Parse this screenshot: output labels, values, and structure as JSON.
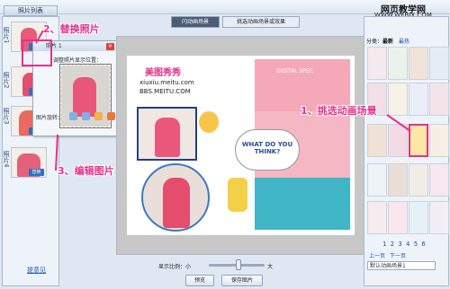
{
  "left": {
    "header": "照片列表",
    "slots": [
      "照片1",
      "照片2",
      "照片3",
      "照片4"
    ],
    "thumb_button": "替换",
    "feedback": "提意见"
  },
  "edit_panel": {
    "title": "照片 1",
    "hint": "调整照片显示位置：",
    "rotate_label": "图片旋转："
  },
  "tabs": [
    "闪动画场景",
    "挑选动画场景或效果"
  ],
  "poster": {
    "title": "美图秀秀",
    "url": "xiuxiu.meitu.com",
    "site": "BBS.MEITU.COM",
    "bubble": "WHAT DO YOU THINK?",
    "spec_text": "DIGITAL SPEC"
  },
  "bottom": {
    "zoom_label": "显示比例：",
    "zoom_min": "小",
    "zoom_max": "大",
    "preview": "预览",
    "save": "保存图片"
  },
  "right": {
    "watermark": "网页教学网",
    "watermark_url": "WWW.WEBJX.COM",
    "filter_label": "分类：",
    "filter_value": "最新",
    "hot": "最热",
    "pages": "1 2 3 4 5 6",
    "prev": "上一页",
    "next": "下一页",
    "dropdown": "默认动画场景1"
  },
  "annotations": {
    "step1": "1、挑选动画场景",
    "step2": "2、替换照片",
    "step3": "3、编辑图片"
  },
  "colors": {
    "annotation": "#e4318a",
    "accent_blue": "#2f6fbf",
    "tab_active": "#4b5d75"
  }
}
